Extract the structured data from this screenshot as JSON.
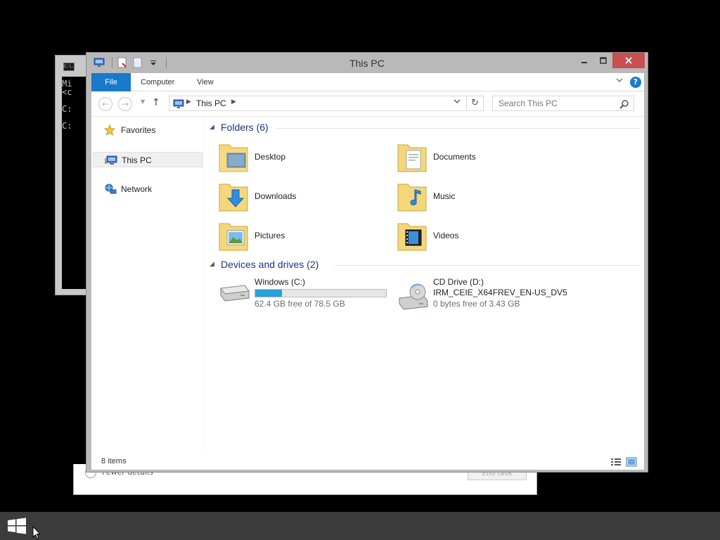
{
  "background_windows": {
    "cmd": {
      "icon_text": "C:\\.",
      "lines": [
        "Mi",
        "<c",
        "C:",
        "C:"
      ]
    },
    "task_manager": {
      "details_label": "Fewer details",
      "end_task_label": "End task"
    }
  },
  "explorer": {
    "title": "This PC",
    "ribbon": {
      "tabs": [
        {
          "label": "File",
          "active": true
        },
        {
          "label": "Computer",
          "active": false
        },
        {
          "label": "View",
          "active": false
        }
      ],
      "help": "?"
    },
    "navbar": {
      "back": "←",
      "forward": "→",
      "up": "↑",
      "breadcrumb": [
        "This PC"
      ],
      "refresh": "↻",
      "search_placeholder": "Search This PC"
    },
    "nav_pane": [
      {
        "label": "Favorites",
        "icon": "star-icon",
        "selected": false
      },
      {
        "label": "This PC",
        "icon": "computer-icon",
        "selected": true
      },
      {
        "label": "Network",
        "icon": "network-icon",
        "selected": false
      }
    ],
    "groups": {
      "folders_title": "Folders (6)",
      "drives_title": "Devices and drives (2)"
    },
    "folders": [
      {
        "label": "Desktop",
        "icon": "desktop-folder-icon"
      },
      {
        "label": "Documents",
        "icon": "documents-folder-icon"
      },
      {
        "label": "Downloads",
        "icon": "downloads-folder-icon"
      },
      {
        "label": "Music",
        "icon": "music-folder-icon"
      },
      {
        "label": "Pictures",
        "icon": "pictures-folder-icon"
      },
      {
        "label": "Videos",
        "icon": "videos-folder-icon"
      }
    ],
    "drives": [
      {
        "name": "Windows (C:)",
        "free_text": "62.4 GB free of 78.5 GB",
        "used_fraction": 0.205,
        "bar_color": "#26a0da",
        "icon": "hard-drive-icon"
      },
      {
        "name": "CD Drive (D:)",
        "label": "IRM_CEIE_X64FREV_EN-US_DV5",
        "free_text": "0 bytes free of 3.43 GB",
        "icon": "cd-drive-icon"
      }
    ],
    "status": {
      "item_count": "8 items"
    }
  },
  "colors": {
    "accent": "#1979ca",
    "group_title": "#1e3287",
    "close_button": "#c75050",
    "taskbar": "#3c3c3c"
  }
}
